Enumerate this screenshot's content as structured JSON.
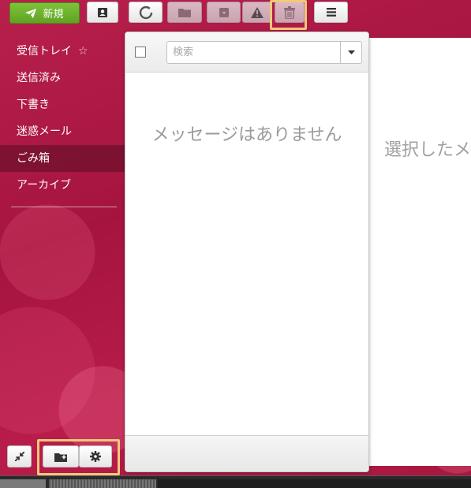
{
  "toolbar": {
    "new_label": "新規",
    "buttons": [
      "send-icon",
      "contacts-icon",
      "refresh-icon",
      "folder-icon",
      "archive-icon",
      "spam-icon",
      "trash-icon",
      "menu-icon"
    ]
  },
  "sidebar": {
    "folders": [
      {
        "label": "受信トレイ",
        "star": "☆"
      },
      {
        "label": "送信済み"
      },
      {
        "label": "下書き"
      },
      {
        "label": "迷惑メール"
      },
      {
        "label": "ごみ箱",
        "active": true
      },
      {
        "label": "アーカイブ"
      }
    ]
  },
  "message_list": {
    "search_placeholder": "検索",
    "empty_text": "メッセージはありません"
  },
  "preview": {
    "empty_text": "選択したメッセージはありません"
  },
  "colors": {
    "accent_green": "#6ab42c",
    "theme_crimson": "#b01a47",
    "highlight": "#f2c879"
  }
}
